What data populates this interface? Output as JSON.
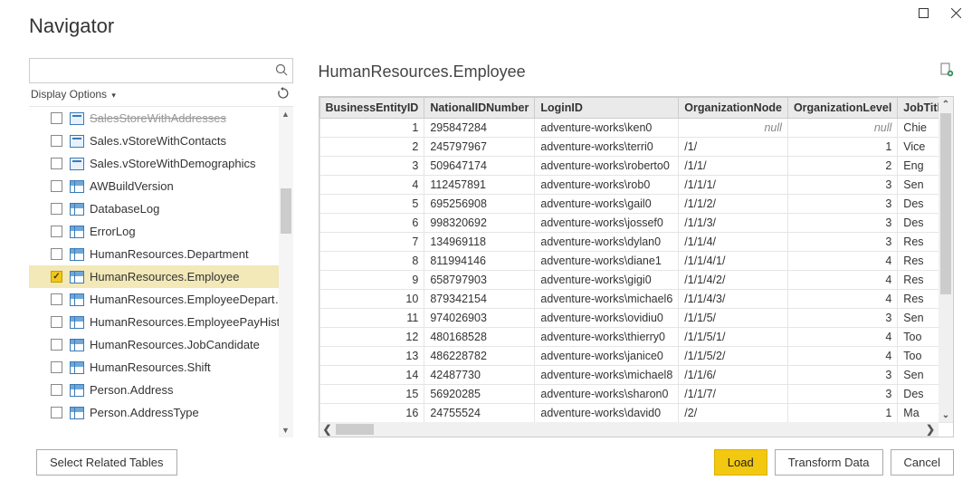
{
  "window": {
    "title": "Navigator"
  },
  "search": {
    "placeholder": ""
  },
  "display_options_label": "Display Options",
  "tree": {
    "items": [
      {
        "label": "SalesStoreWithAddresses",
        "icon": "view",
        "checked": false,
        "cut": true
      },
      {
        "label": "Sales.vStoreWithContacts",
        "icon": "view",
        "checked": false
      },
      {
        "label": "Sales.vStoreWithDemographics",
        "icon": "view",
        "checked": false
      },
      {
        "label": "AWBuildVersion",
        "icon": "table",
        "checked": false
      },
      {
        "label": "DatabaseLog",
        "icon": "table",
        "checked": false
      },
      {
        "label": "ErrorLog",
        "icon": "table",
        "checked": false
      },
      {
        "label": "HumanResources.Department",
        "icon": "table",
        "checked": false
      },
      {
        "label": "HumanResources.Employee",
        "icon": "table",
        "checked": true,
        "selected": true
      },
      {
        "label": "HumanResources.EmployeeDepartmen...",
        "icon": "table",
        "checked": false
      },
      {
        "label": "HumanResources.EmployeePayHistory",
        "icon": "table",
        "checked": false
      },
      {
        "label": "HumanResources.JobCandidate",
        "icon": "table",
        "checked": false
      },
      {
        "label": "HumanResources.Shift",
        "icon": "table",
        "checked": false
      },
      {
        "label": "Person.Address",
        "icon": "table",
        "checked": false
      },
      {
        "label": "Person.AddressType",
        "icon": "table",
        "checked": false
      }
    ]
  },
  "preview": {
    "title": "HumanResources.Employee",
    "columns": [
      "BusinessEntityID",
      "NationalIDNumber",
      "LoginID",
      "OrganizationNode",
      "OrganizationLevel",
      "JobTitle"
    ],
    "rows": [
      {
        "id": "1",
        "nid": "295847284",
        "login": "adventure-works\\ken0",
        "node": null,
        "level": null,
        "job": "Chie"
      },
      {
        "id": "2",
        "nid": "245797967",
        "login": "adventure-works\\terri0",
        "node": "/1/",
        "level": "1",
        "job": "Vice"
      },
      {
        "id": "3",
        "nid": "509647174",
        "login": "adventure-works\\roberto0",
        "node": "/1/1/",
        "level": "2",
        "job": "Eng"
      },
      {
        "id": "4",
        "nid": "112457891",
        "login": "adventure-works\\rob0",
        "node": "/1/1/1/",
        "level": "3",
        "job": "Sen"
      },
      {
        "id": "5",
        "nid": "695256908",
        "login": "adventure-works\\gail0",
        "node": "/1/1/2/",
        "level": "3",
        "job": "Des"
      },
      {
        "id": "6",
        "nid": "998320692",
        "login": "adventure-works\\jossef0",
        "node": "/1/1/3/",
        "level": "3",
        "job": "Des"
      },
      {
        "id": "7",
        "nid": "134969118",
        "login": "adventure-works\\dylan0",
        "node": "/1/1/4/",
        "level": "3",
        "job": "Res"
      },
      {
        "id": "8",
        "nid": "811994146",
        "login": "adventure-works\\diane1",
        "node": "/1/1/4/1/",
        "level": "4",
        "job": "Res"
      },
      {
        "id": "9",
        "nid": "658797903",
        "login": "adventure-works\\gigi0",
        "node": "/1/1/4/2/",
        "level": "4",
        "job": "Res"
      },
      {
        "id": "10",
        "nid": "879342154",
        "login": "adventure-works\\michael6",
        "node": "/1/1/4/3/",
        "level": "4",
        "job": "Res"
      },
      {
        "id": "11",
        "nid": "974026903",
        "login": "adventure-works\\ovidiu0",
        "node": "/1/1/5/",
        "level": "3",
        "job": "Sen"
      },
      {
        "id": "12",
        "nid": "480168528",
        "login": "adventure-works\\thierry0",
        "node": "/1/1/5/1/",
        "level": "4",
        "job": "Too"
      },
      {
        "id": "13",
        "nid": "486228782",
        "login": "adventure-works\\janice0",
        "node": "/1/1/5/2/",
        "level": "4",
        "job": "Too"
      },
      {
        "id": "14",
        "nid": "42487730",
        "login": "adventure-works\\michael8",
        "node": "/1/1/6/",
        "level": "3",
        "job": "Sen"
      },
      {
        "id": "15",
        "nid": "56920285",
        "login": "adventure-works\\sharon0",
        "node": "/1/1/7/",
        "level": "3",
        "job": "Des"
      },
      {
        "id": "16",
        "nid": "24755524",
        "login": "adventure-works\\david0",
        "node": "/2/",
        "level": "1",
        "job": "Ma"
      }
    ]
  },
  "footer": {
    "select_related": "Select Related Tables",
    "load": "Load",
    "transform": "Transform Data",
    "cancel": "Cancel"
  },
  "null_label": "null"
}
